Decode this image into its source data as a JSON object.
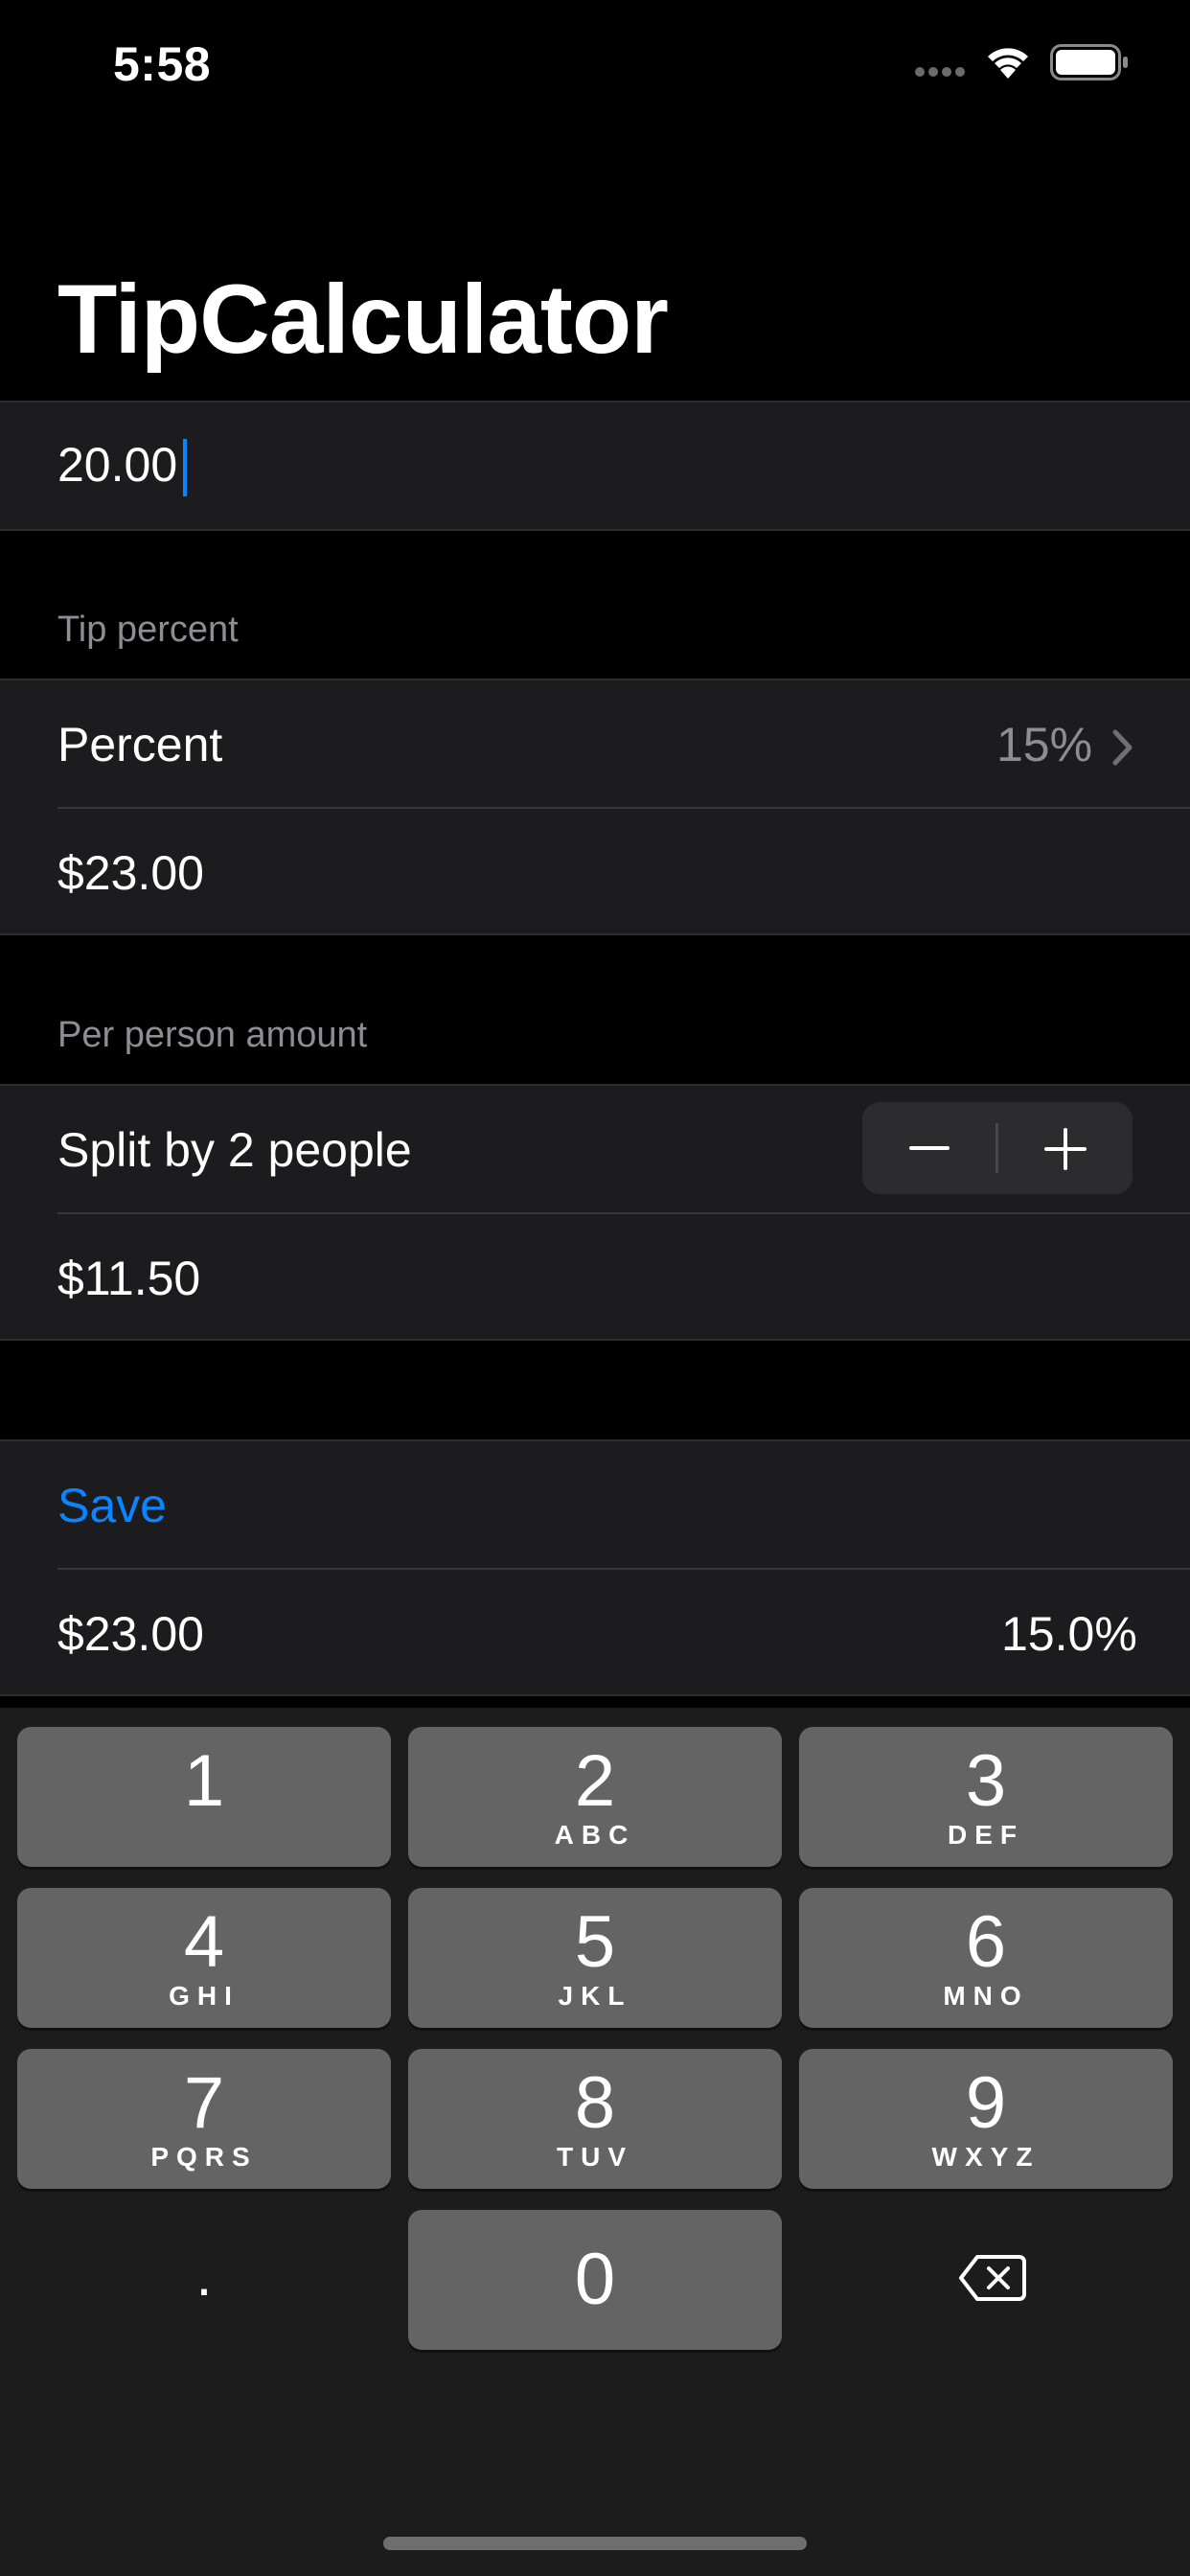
{
  "status_bar": {
    "time": "5:58",
    "icons": [
      "signal-dots-icon",
      "wifi-icon",
      "battery-icon"
    ]
  },
  "app": {
    "title": "TipCalculator"
  },
  "amount_input": {
    "value": "20.00"
  },
  "tip_section": {
    "header": "Tip percent",
    "percent_label": "Percent",
    "percent_value": "15%",
    "total": "$23.00"
  },
  "per_person_section": {
    "header": "Per person amount",
    "split_label": "Split by 2 people",
    "amount": "$11.50"
  },
  "history_section": {
    "save_label": "Save",
    "entries": [
      {
        "total": "$23.00",
        "percent": "15.0%"
      }
    ]
  },
  "keyboard": {
    "keys": [
      {
        "digit": "1",
        "letters": ""
      },
      {
        "digit": "2",
        "letters": "ABC"
      },
      {
        "digit": "3",
        "letters": "DEF"
      },
      {
        "digit": "4",
        "letters": "GHI"
      },
      {
        "digit": "5",
        "letters": "JKL"
      },
      {
        "digit": "6",
        "letters": "MNO"
      },
      {
        "digit": "7",
        "letters": "PQRS"
      },
      {
        "digit": "8",
        "letters": "TUV"
      },
      {
        "digit": "9",
        "letters": "WXYZ"
      },
      {
        "digit": "0",
        "letters": ""
      }
    ],
    "decimal": ".",
    "delete_icon": "backspace-icon"
  },
  "colors": {
    "accent": "#0a84ff",
    "cell_background": "#1c1c1e",
    "secondary_text": "#8d8d93",
    "key_background": "#646464"
  }
}
